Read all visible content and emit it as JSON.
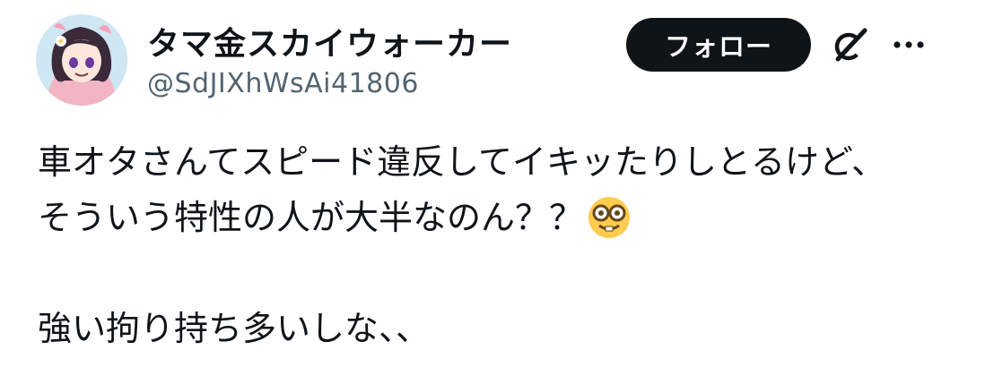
{
  "tweet": {
    "display_name": "タマ金スカイウォーカー",
    "handle": "@SdJIXhWsAi41806",
    "follow_label": "フォロー",
    "lines": [
      "車オタさんてスピード違反してイキッたりしとるけど、",
      "そういう特性の人が大半なのん？？",
      "強い拘り持ち多いしな、、"
    ],
    "emoji": "nerd-face",
    "icons": {
      "grok": "grok-icon",
      "more": "more-icon"
    }
  }
}
